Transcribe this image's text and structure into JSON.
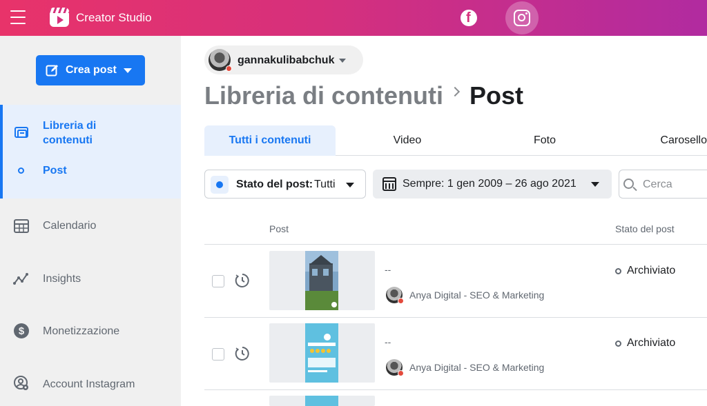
{
  "app": {
    "name": "Creator Studio"
  },
  "topbar": {
    "menu_icon": "hamburger-menu-icon",
    "platforms": [
      "facebook-icon",
      "instagram-icon"
    ],
    "active_platform": "instagram"
  },
  "sidebar": {
    "create_button": "Crea post",
    "items": [
      {
        "label": "Libreria di contenuti",
        "icon": "content-library-icon",
        "active": true
      },
      {
        "label": "Post",
        "active": true
      },
      {
        "label": "Calendario",
        "icon": "calendar-icon"
      },
      {
        "label": "Insights",
        "icon": "insights-icon"
      },
      {
        "label": "Monetizzazione",
        "icon": "dollar-icon"
      },
      {
        "label": "Account Instagram",
        "icon": "account-settings-icon"
      }
    ]
  },
  "account": {
    "name": "gannakulibabchuk"
  },
  "breadcrumb": {
    "root": "Libreria di contenuti",
    "current": "Post"
  },
  "tabs": [
    {
      "label": "Tutti i contenuti",
      "active": true
    },
    {
      "label": "Video"
    },
    {
      "label": "Foto"
    },
    {
      "label": "Carosello"
    }
  ],
  "filters": {
    "status_label": "Stato del post:",
    "status_value": "Tutti",
    "date_value": "Sempre: 1 gen 2009 – 26 ago 2021",
    "search_placeholder": "Cerca"
  },
  "table": {
    "columns": [
      "Post",
      "Stato del post"
    ],
    "rows": [
      {
        "title": "--",
        "account": "Anya Digital - SEO & Marketing",
        "status": "Archiviato"
      },
      {
        "title": "--",
        "account": "Anya Digital - SEO & Marketing",
        "status": "Archiviato"
      }
    ]
  },
  "colors": {
    "accent": "#1877f2",
    "topbar_start": "#e8336a",
    "topbar_end": "#b12ba0"
  }
}
